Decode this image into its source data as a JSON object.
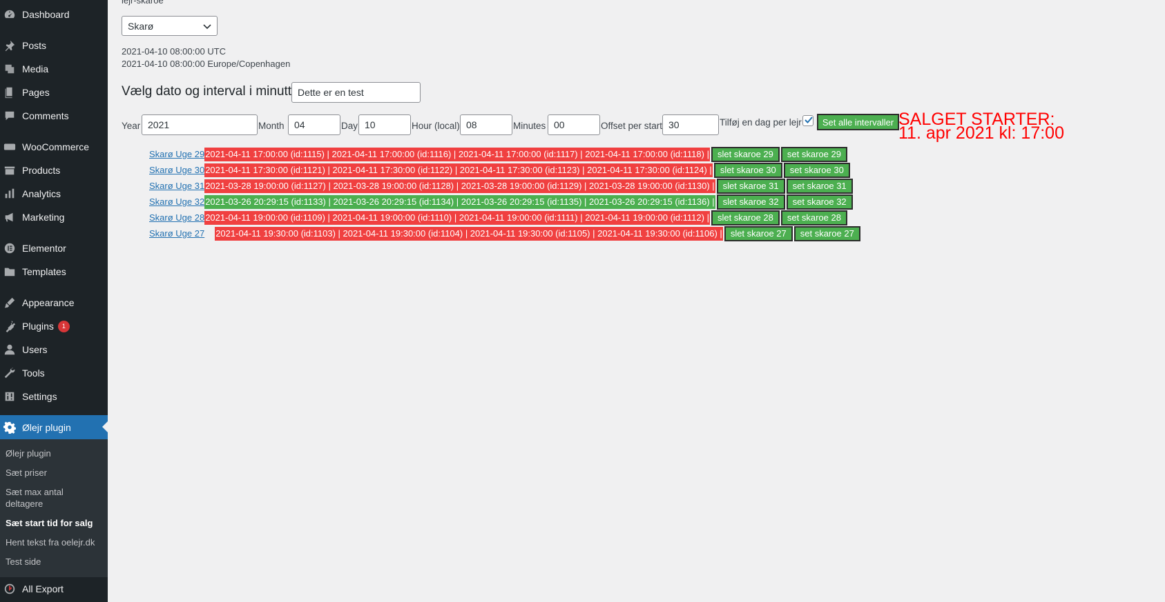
{
  "sidebar": {
    "items": [
      {
        "label": "Dashboard",
        "icon": "dashboard-icon"
      },
      {
        "label": "Posts",
        "icon": "pin-icon"
      },
      {
        "label": "Media",
        "icon": "media-icon"
      },
      {
        "label": "Pages",
        "icon": "pages-icon"
      },
      {
        "label": "Comments",
        "icon": "comment-icon"
      },
      {
        "label": "WooCommerce",
        "icon": "woo-icon"
      },
      {
        "label": "Products",
        "icon": "archive-icon"
      },
      {
        "label": "Analytics",
        "icon": "bar-chart-icon"
      },
      {
        "label": "Marketing",
        "icon": "megaphone-icon"
      },
      {
        "label": "Elementor",
        "icon": "elementor-icon"
      },
      {
        "label": "Templates",
        "icon": "folder-icon"
      },
      {
        "label": "Appearance",
        "icon": "brush-icon"
      },
      {
        "label": "Plugins",
        "icon": "plug-icon",
        "badge": "1"
      },
      {
        "label": "Users",
        "icon": "user-icon"
      },
      {
        "label": "Tools",
        "icon": "wrench-icon"
      },
      {
        "label": "Settings",
        "icon": "sliders-icon"
      },
      {
        "label": "Ølejr plugin",
        "icon": "gear-icon",
        "active": true
      }
    ],
    "submenu": [
      "Ølejr plugin",
      "Sæt priser",
      "Sæt max antal deltagere",
      "Sæt start tid for salg",
      "Hent tekst fra oelejr.dk",
      "Test side"
    ],
    "footer_item": {
      "label": "All Export",
      "icon": "export-icon"
    }
  },
  "main": {
    "top_label": "lejr-skaroe",
    "select_value": "Skarø",
    "date_utc": "2021-04-10 08:00:00 UTC",
    "date_local": "2021-04-10 08:00:00 Europe/Copenhagen",
    "heading": "Vælg dato og interval i minutter",
    "heading_input": "Dette er en test",
    "fields": {
      "year_label": "Year",
      "year": "2021",
      "month_label": "Month",
      "month": "04",
      "day_label": "Day",
      "day": "10",
      "hour_label": "Hour (local)",
      "hour": "08",
      "minutes_label": "Minutes",
      "minutes": "00",
      "offset_label": "Offset per start",
      "offset": "30",
      "add_day_label": "Tilføj en dag per lejr",
      "add_day_checked": true
    },
    "set_all_button": "Set alle intervaller",
    "salget_line1": "SALGET STARTER:",
    "salget_line2": "11. apr 2021 kl: 17:00",
    "colors": {
      "red": "#f04040",
      "green": "#4caf50",
      "salget": "#ff0000"
    },
    "rows": [
      {
        "link": "Skarø Uge 29",
        "status": "red",
        "dates": "2021-04-11 17:00:00 (id:1115) | 2021-04-11 17:00:00 (id:1116) | 2021-04-11 17:00:00 (id:1117) | 2021-04-11 17:00:00 (id:1118) |",
        "slet": "slet skaroe 29",
        "set": "set skaroe 29"
      },
      {
        "link": "Skarø Uge 30",
        "status": "red",
        "dates": "2021-04-11 17:30:00 (id:1121) | 2021-04-11 17:30:00 (id:1122) | 2021-04-11 17:30:00 (id:1123) | 2021-04-11 17:30:00 (id:1124) |",
        "slet": "slet skaroe 30",
        "set": "set skaroe 30"
      },
      {
        "link": "Skarø Uge 31",
        "status": "red",
        "dates": "2021-03-28 19:00:00 (id:1127) | 2021-03-28 19:00:00 (id:1128) | 2021-03-28 19:00:00 (id:1129) | 2021-03-28 19:00:00 (id:1130) |",
        "slet": "slet skaroe 31",
        "set": "set skaroe 31"
      },
      {
        "link": "Skarø Uge 32",
        "status": "green",
        "dates": "2021-03-26 20:29:15 (id:1133) | 2021-03-26 20:29:15 (id:1134) | 2021-03-26 20:29:15 (id:1135) | 2021-03-26 20:29:15 (id:1136) |",
        "slet": "slet skaroe 32",
        "set": "set skaroe 32"
      },
      {
        "link": "Skarø Uge 28",
        "status": "red",
        "dates": "2021-04-11 19:00:00 (id:1109) | 2021-04-11 19:00:00 (id:1110) | 2021-04-11 19:00:00 (id:1111) | 2021-04-11 19:00:00 (id:1112) |",
        "slet": "slet skaroe 28",
        "set": "set skaroe 28"
      },
      {
        "link": "Skarø Uge 27",
        "status": "red",
        "dates": "2021-04-11 19:30:00 (id:1103) | 2021-04-11 19:30:00 (id:1104) | 2021-04-11 19:30:00 (id:1105) | 2021-04-11 19:30:00 (id:1106) |",
        "slet": "slet skaroe 27",
        "set": "set skaroe 27"
      }
    ]
  }
}
